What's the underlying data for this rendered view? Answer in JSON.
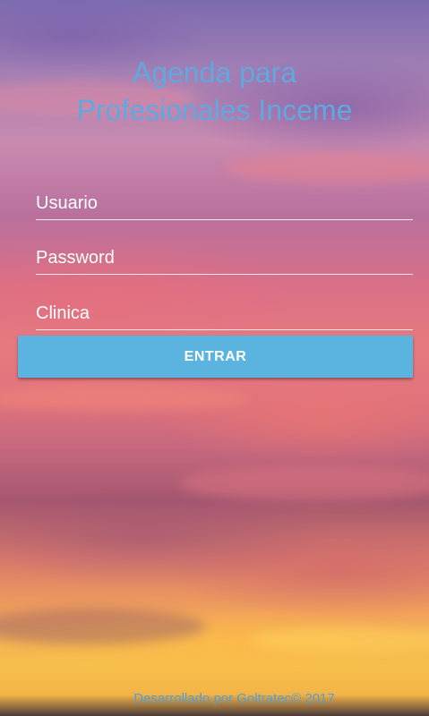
{
  "header": {
    "title_line1": "Agenda para",
    "title_line2": "Profesionales Inceme"
  },
  "form": {
    "username_placeholder": "Usuario",
    "username_value": "",
    "password_placeholder": "Password",
    "password_value": "",
    "clinic_placeholder": "Clinica",
    "clinic_value": "",
    "submit_label": "ENTRAR"
  },
  "footer": {
    "credit": "Desarrollado por Goltratec© 2017"
  },
  "colors": {
    "title": "#5fa8e0",
    "button": "#5bb3e0",
    "footer": "#4f9fd8"
  }
}
